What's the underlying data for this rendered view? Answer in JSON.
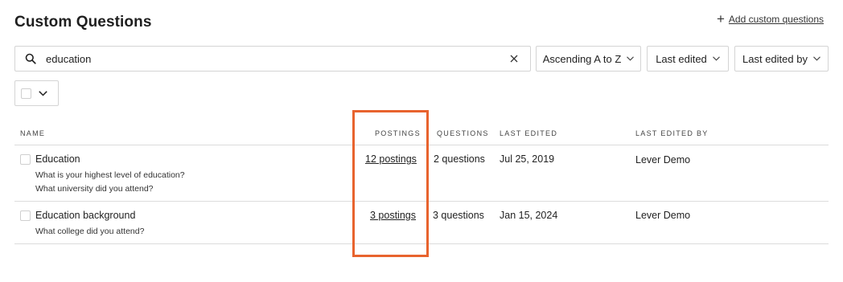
{
  "page": {
    "title": "Custom Questions",
    "add_label": "Add custom questions"
  },
  "search": {
    "value": "education"
  },
  "filters": {
    "sort": "Ascending A to Z",
    "last_edited": "Last edited",
    "last_edited_by": "Last edited by"
  },
  "table": {
    "headers": {
      "name": "NAME",
      "postings": "POSTINGS",
      "questions": "QUESTIONS",
      "last_edited": "LAST EDITED",
      "last_edited_by": "LAST EDITED BY"
    },
    "rows": [
      {
        "name": "Education",
        "subquestions": [
          "What is your highest level of education?",
          "What university did you attend?"
        ],
        "postings": "12 postings",
        "questions": "2 questions",
        "last_edited": "Jul 25, 2019",
        "last_edited_by": "Lever Demo"
      },
      {
        "name": "Education background",
        "subquestions": [
          "What college did you attend?"
        ],
        "postings": "3 postings",
        "questions": "3 questions",
        "last_edited": "Jan 15, 2024",
        "last_edited_by": "Lever Demo"
      }
    ]
  },
  "colors": {
    "highlight": "#e8632e",
    "border": "#d4d4d4"
  },
  "icons": {
    "search": "search-icon",
    "clear": "close-icon",
    "chevron": "chevron-down-icon",
    "plus": "plus-icon"
  }
}
